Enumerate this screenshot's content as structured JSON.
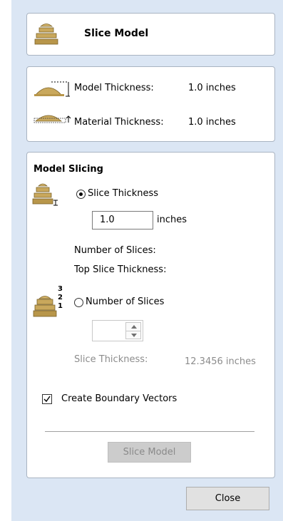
{
  "header": {
    "title": "Slice Model",
    "icon": "dome-slice-icon"
  },
  "thickness_info": {
    "model_label": "Model Thickness:",
    "model_value": "1.0 inches",
    "material_label": "Material Thickness:",
    "material_value": "1.0 inches"
  },
  "slicing": {
    "section_title": "Model Slicing",
    "option_slice_thickness": {
      "label": "Slice Thickness",
      "selected": true,
      "value": "1.0",
      "unit": "inches"
    },
    "number_of_slices_label": "Number of Slices:",
    "top_slice_thickness_label": "Top Slice Thickness:",
    "option_number_of_slices": {
      "label": "Number of Slices",
      "selected": false,
      "stack_numbers": [
        "3",
        "2",
        "1"
      ]
    },
    "slice_thickness_readout_label": "Slice Thickness:",
    "slice_thickness_readout_value": "12.3456 inches",
    "create_boundary_vectors": {
      "label": "Create Boundary Vectors",
      "checked": true
    },
    "slice_model_button": "Slice Model"
  },
  "footer": {
    "close_button": "Close"
  },
  "colors": {
    "panel_background": "#dbe6f4",
    "dome_gold": "#c9a85c",
    "disabled_text": "#8c8c8c"
  }
}
